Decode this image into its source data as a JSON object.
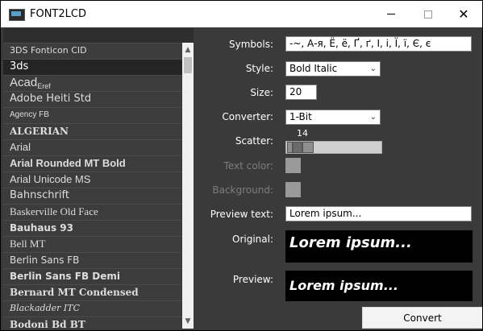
{
  "window": {
    "title": "FONT2LCD"
  },
  "fonts": [
    {
      "label": "3DS  Fonticon  CID",
      "family": "\"DejaVu Sans\", sans-serif",
      "size": 11,
      "weight": "normal",
      "style": "normal"
    },
    {
      "label": "3ds",
      "family": "\"DejaVu Sans\", sans-serif",
      "size": 13,
      "weight": "normal",
      "style": "normal"
    },
    {
      "label": "Acad",
      "suffix": "Eref",
      "family": "\"Liberation Sans\", sans-serif",
      "size": 15,
      "weight": "normal",
      "style": "normal"
    },
    {
      "label": "Adobe Heiti Std",
      "family": "\"DejaVu Sans\", sans-serif",
      "size": 13,
      "weight": "normal",
      "style": "normal"
    },
    {
      "label": "Agency FB",
      "family": "\"Liberation Sans Narrow\", \"Liberation Sans\", sans-serif",
      "size": 10,
      "weight": "normal",
      "style": "normal"
    },
    {
      "label": "ALGERIAN",
      "family": "\"DejaVu Serif\", serif",
      "size": 12,
      "weight": "bold",
      "style": "normal"
    },
    {
      "label": "Arial",
      "family": "\"Liberation Sans\", sans-serif",
      "size": 13,
      "weight": "normal",
      "style": "normal"
    },
    {
      "label": "Arial Rounded MT Bold",
      "family": "\"Liberation Sans\", sans-serif",
      "size": 13,
      "weight": "bold",
      "style": "normal"
    },
    {
      "label": "Arial Unicode MS",
      "family": "\"Liberation Sans\", sans-serif",
      "size": 13,
      "weight": "normal",
      "style": "normal"
    },
    {
      "label": "Bahnschrift",
      "family": "\"DejaVu Sans\", sans-serif",
      "size": 13,
      "weight": "normal",
      "style": "normal"
    },
    {
      "label": "Baskerville Old Face",
      "family": "\"Liberation Serif\", serif",
      "size": 13,
      "weight": "normal",
      "style": "normal"
    },
    {
      "label": "Bauhaus 93",
      "family": "\"DejaVu Sans\", sans-serif",
      "size": 12,
      "weight": "bold",
      "style": "normal"
    },
    {
      "label": "Bell MT",
      "family": "\"Liberation Serif\", serif",
      "size": 13,
      "weight": "normal",
      "style": "normal"
    },
    {
      "label": "Berlin Sans FB",
      "family": "\"DejaVu Sans\", sans-serif",
      "size": 12,
      "weight": "normal",
      "style": "normal"
    },
    {
      "label": "Berlin Sans FB Demi",
      "family": "\"DejaVu Sans\", sans-serif",
      "size": 12,
      "weight": "bold",
      "style": "normal"
    },
    {
      "label": "Bernard MT Condensed",
      "family": "\"DejaVu Serif\", serif",
      "size": 12,
      "weight": "bold",
      "style": "normal"
    },
    {
      "label": "Blackadder ITC",
      "family": "\"DejaVu Serif\", serif",
      "size": 11,
      "weight": "normal",
      "style": "italic"
    },
    {
      "label": "Bodoni Bd BT",
      "family": "\"DejaVu Serif\", serif",
      "size": 12,
      "weight": "bold",
      "style": "normal"
    }
  ],
  "selected_font_index": 1,
  "form": {
    "symbols_label": "Symbols:",
    "symbols_value": " -~, А-я, Ё, ё, Ґ, ґ, І, і, Ї, ї, Є, є",
    "style_label": "Style:",
    "style_value": "Bold Italic",
    "size_label": "Size:",
    "size_value": "20",
    "converter_label": "Converter:",
    "converter_value": "1-Bit",
    "scatter_label": "Scatter:",
    "scatter_value": "14",
    "text_color_label": "Text color:",
    "background_label": "Background:",
    "preview_text_label": "Preview text:",
    "preview_text_value": "Lorem ipsum...",
    "original_label": "Original:",
    "original_text": "Lorem ipsum...",
    "preview_label": "Preview:",
    "preview_text": "Lorem ipsum...",
    "convert_label": "Convert"
  },
  "colors": {
    "swatch": "#9a9a9a",
    "preview_bg": "#000000",
    "preview_fg": "#ffffff"
  },
  "icons": {
    "scroll_up": "chevron-up-icon",
    "scroll_down": "chevron-down-icon",
    "combo": "chevron-down-icon"
  }
}
